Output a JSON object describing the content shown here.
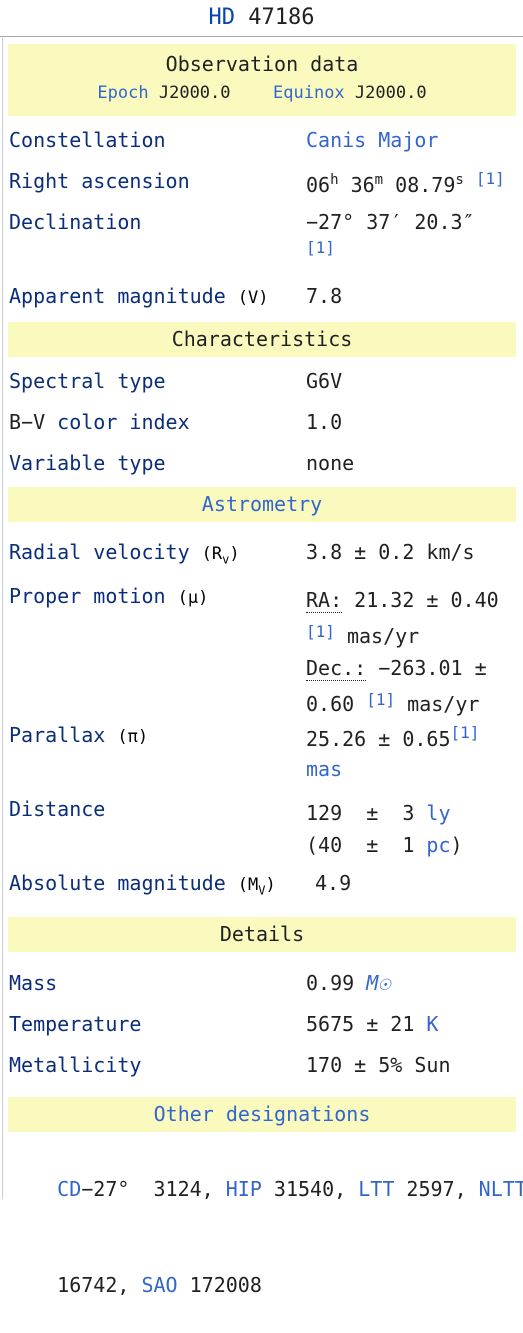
{
  "title": {
    "prefix": "HD",
    "number": "47186"
  },
  "observation": {
    "header": "Observation data",
    "epoch_label": "Epoch",
    "epoch_value": "J2000.0",
    "equinox_label": "Equinox",
    "equinox_value": "J2000.0"
  },
  "constellation": {
    "label": "Constellation",
    "value": "Canis Major"
  },
  "ra": {
    "label": "Right ascension",
    "h": "06",
    "h_unit": "h",
    "m": "36",
    "m_unit": "m",
    "s": "08.79",
    "s_unit": "s",
    "ref": "[1]"
  },
  "dec": {
    "label": "Declination",
    "value": "−27°  37′  20.3″",
    "ref": "[1]"
  },
  "app_mag": {
    "label": "Apparent magnitude",
    "paren": "(V)",
    "value": "7.8"
  },
  "characteristics": {
    "header": "Characteristics",
    "spectral": {
      "label": "Spectral type",
      "value": "G6V"
    },
    "bv": {
      "label_a": "B−V",
      "label_b": "color index",
      "value": "1.0"
    },
    "variable": {
      "label": "Variable type",
      "value": "none"
    }
  },
  "astrometry": {
    "header": "Astrometry",
    "rv": {
      "label": "Radial velocity",
      "paren_open": "(R",
      "paren_sub": "v",
      "paren_close": ")",
      "value": "3.8  ±  0.2 km/s"
    },
    "pm": {
      "label": "Proper motion",
      "paren": "(μ)",
      "ra_label": "RA:",
      "ra_value": " 21.32  ±  0.40",
      "ref": "[1]",
      "unit": "mas/yr",
      "dec_label": "Dec.:",
      "dec_value": " −263.01  ±",
      "dec_value2": "0.60"
    },
    "parallax": {
      "label": "Parallax",
      "paren": "(π)",
      "value": "25.26  ±  0.65",
      "ref": "[1]",
      "unit": "mas"
    },
    "distance": {
      "label": "Distance",
      "value": "129  ±  3 ",
      "unit1": "ly",
      "value2_a": "(40  ±  1 ",
      "unit2": "pc",
      "value2_b": ")"
    },
    "abs_mag": {
      "label": "Absolute magnitude",
      "paren_open": "(M",
      "paren_sub": "V",
      "paren_close": ")",
      "value": "4.9"
    }
  },
  "details": {
    "header": "Details",
    "mass": {
      "label": "Mass",
      "value": "0.99 ",
      "unit": "M☉"
    },
    "temperature": {
      "label": "Temperature",
      "value": "5675  ±  21 ",
      "unit": "K"
    },
    "metallicity": {
      "label": "Metallicity",
      "value": "170  ±  5% Sun"
    }
  },
  "designations": {
    "header": "Other designations",
    "cd_link": "CD",
    "cd_value": "−27°  3124,",
    "hip_link": "HIP",
    "hip_value": " 31540,",
    "ltt_link": "LTT",
    "ltt_value": " 2597,",
    "nltt_link": "NLTT",
    "nltt_value": "16742,",
    "sao_link": "SAO",
    "sao_value": " 172008"
  }
}
